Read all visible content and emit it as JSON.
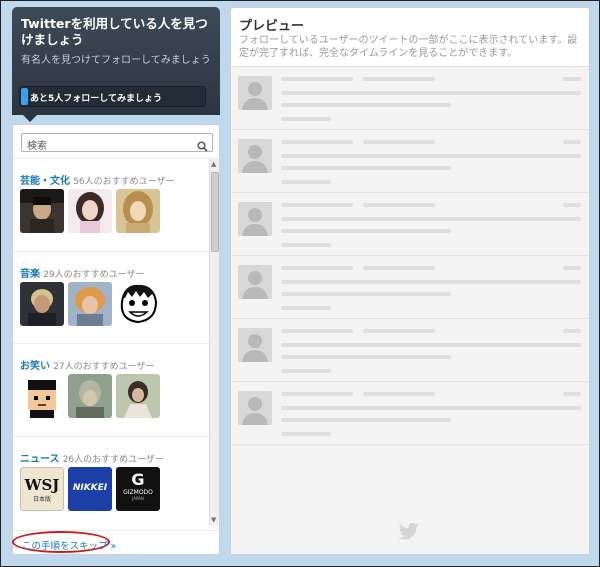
{
  "header": {
    "title": "Twitterを利用している人を見つけましょう",
    "subtitle": "有名人を見つけてフォローしてみましょう",
    "progress_text": "あと5人フォローしてみましょう",
    "progress_fraction": 0.04
  },
  "search": {
    "placeholder": "検索"
  },
  "categories": [
    {
      "name": "芸能・文化",
      "count": "56人のおすすめユーザー"
    },
    {
      "name": "音楽",
      "count": "29人のおすすめユーザー"
    },
    {
      "name": "お笑い",
      "count": "27人のおすすめユーザー"
    },
    {
      "name": "ニュース",
      "count": "26人のおすすめユーザー"
    }
  ],
  "news_logos": {
    "wsj": "WSJ",
    "wsj_sub": "日本版",
    "nikkei": "NIKKEI",
    "gizmodo_mark": "G",
    "gizmodo": "GIZMODO",
    "gizmodo_sub": "JAPAN"
  },
  "skip": {
    "label": "この手順をスキップ »"
  },
  "preview": {
    "title": "プレビュー",
    "description": "フォローしているユーザーのツイートの一部がここに表示されています。設定が完了すれば、完全なタイムラインを見ることができます。"
  },
  "colors": {
    "accent": "#1a7ab8",
    "highlight_ring": "#cc1b1b",
    "header_bg": "#2b3540"
  },
  "icons": {
    "search": "search-icon",
    "bird": "twitter-bird-icon",
    "placeholder_avatar": "default-avatar-icon"
  }
}
